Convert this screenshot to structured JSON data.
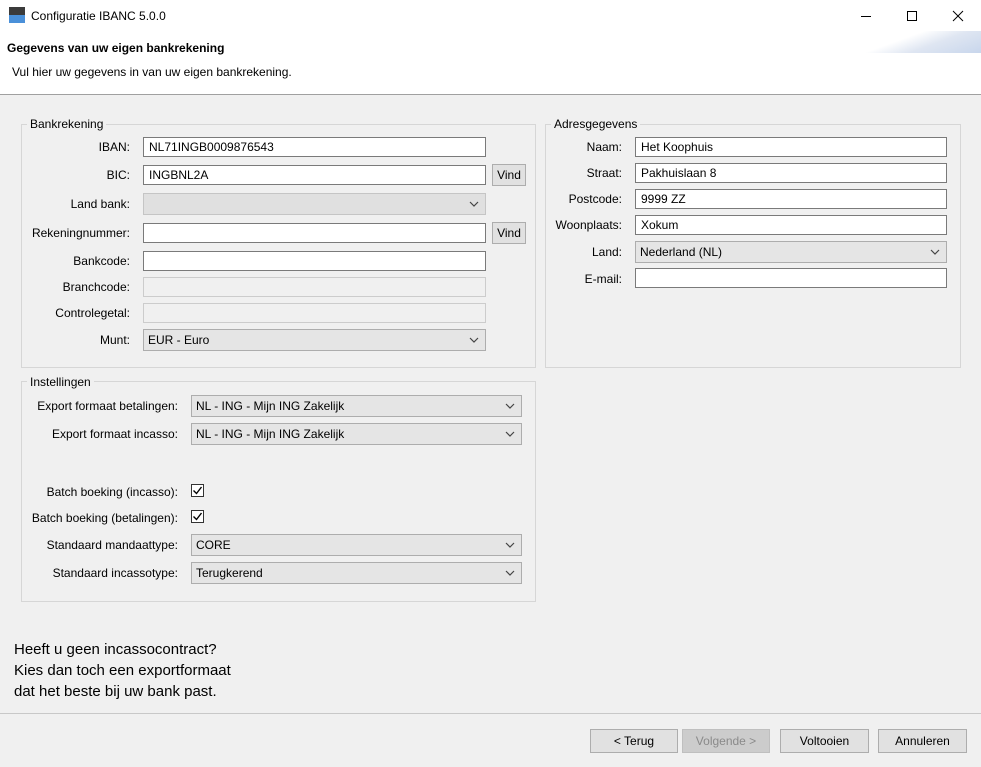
{
  "window": {
    "title": "Configuratie IBANC 5.0.0"
  },
  "header": {
    "title": "Gegevens van uw eigen bankrekening",
    "subtitle": "Vul hier uw gegevens in van uw eigen bankrekening."
  },
  "bankrekening": {
    "group_label": "Bankrekening",
    "iban_label": "IBAN:",
    "iban_value": "NL71INGB0009876543",
    "bic_label": "BIC:",
    "bic_value": "INGBNL2A",
    "find_label": "Vind",
    "land_bank_label": "Land bank:",
    "land_bank_value": "",
    "rekeningnummer_label": "Rekeningnummer:",
    "rekeningnummer_value": "",
    "bankcode_label": "Bankcode:",
    "bankcode_value": "",
    "branchcode_label": "Branchcode:",
    "branchcode_value": "",
    "controlegetal_label": "Controlegetal:",
    "controlegetal_value": "",
    "munt_label": "Munt:",
    "munt_value": "EUR - Euro"
  },
  "adres": {
    "group_label": "Adresgegevens",
    "naam_label": "Naam:",
    "naam_value": "Het Koophuis",
    "straat_label": "Straat:",
    "straat_value": "Pakhuislaan 8",
    "postcode_label": "Postcode:",
    "postcode_value": "9999 ZZ",
    "woonplaats_label": "Woonplaats:",
    "woonplaats_value": "Xokum",
    "land_label": "Land:",
    "land_value": "Nederland (NL)",
    "email_label": "E-mail:",
    "email_value": ""
  },
  "instellingen": {
    "group_label": "Instellingen",
    "export_betalingen_label": "Export formaat betalingen:",
    "export_betalingen_value": "NL - ING - Mijn ING Zakelijk",
    "export_incasso_label": "Export formaat incasso:",
    "export_incasso_value": "NL - ING - Mijn ING Zakelijk",
    "batch_incasso_label": "Batch boeking (incasso):",
    "batch_incasso_checked": true,
    "batch_betalingen_label": "Batch boeking (betalingen):",
    "batch_betalingen_checked": true,
    "mandaattype_label": "Standaard mandaattype:",
    "mandaattype_value": "CORE",
    "incassotype_label": "Standaard incassotype:",
    "incassotype_value": "Terugkerend"
  },
  "info": {
    "line1": "Heeft u geen incassocontract?",
    "line2": "Kies dan toch een exportformaat",
    "line3": "dat het beste bij uw bank past."
  },
  "footer": {
    "back_label": "< Terug",
    "next_label": "Volgende >",
    "finish_label": "Voltooien",
    "cancel_label": "Annuleren"
  }
}
